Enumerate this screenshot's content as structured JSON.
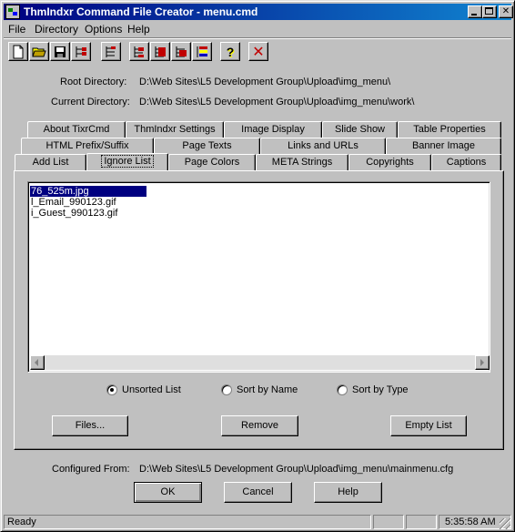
{
  "window": {
    "title": "ThmIndxr Command File Creator - menu.cmd"
  },
  "menubar": [
    "File",
    "Directory",
    "Options",
    "Help"
  ],
  "toolbar": [
    "new-file-icon",
    "open-folder-icon",
    "save-icon",
    "directory-tree-icon",
    "list-add-icon",
    "list-ignore-icon",
    "list-red-icon",
    "list-red-2-icon",
    "list-colors-icon",
    "help-icon",
    "close-icon"
  ],
  "paths": {
    "root_label": "Root Directory:",
    "root_value": "D:\\Web Sites\\L5 Development Group\\Upload\\img_menu\\",
    "current_label": "Current Directory:",
    "current_value": "D:\\Web Sites\\L5 Development Group\\Upload\\img_menu\\work\\"
  },
  "tabs": {
    "row1": [
      "About TixrCmd",
      "ThmIndxr Settings",
      "Image Display",
      "Slide Show",
      "Table Properties"
    ],
    "row2": [
      "HTML Prefix/Suffix",
      "Page Texts",
      "Links and URLs",
      "Banner Image"
    ],
    "row3": [
      "Add List",
      "Ignore List",
      "Page Colors",
      "META Strings",
      "Copyrights",
      "Captions"
    ],
    "active": "Ignore List"
  },
  "ignore_list": {
    "items": [
      "76_525m.jpg",
      "l_Email_990123.gif",
      "i_Guest_990123.gif"
    ]
  },
  "sort": {
    "unsorted": "Unsorted List",
    "by_name": "Sort by Name",
    "by_type": "Sort by Type",
    "selected": "Unsorted List"
  },
  "buttons": {
    "files": "Files...",
    "remove": "Remove",
    "empty": "Empty List",
    "ok": "OK",
    "cancel": "Cancel",
    "help": "Help"
  },
  "config": {
    "label": "Configured From:",
    "value": "D:\\Web Sites\\L5 Development Group\\Upload\\img_menu\\mainmenu.cfg"
  },
  "status": {
    "text": "Ready",
    "time": "5:35:58 AM"
  },
  "colors": {
    "title_start": "#000080",
    "title_end": "#1084d0",
    "face": "#c0c0c0",
    "selection": "#000080"
  }
}
